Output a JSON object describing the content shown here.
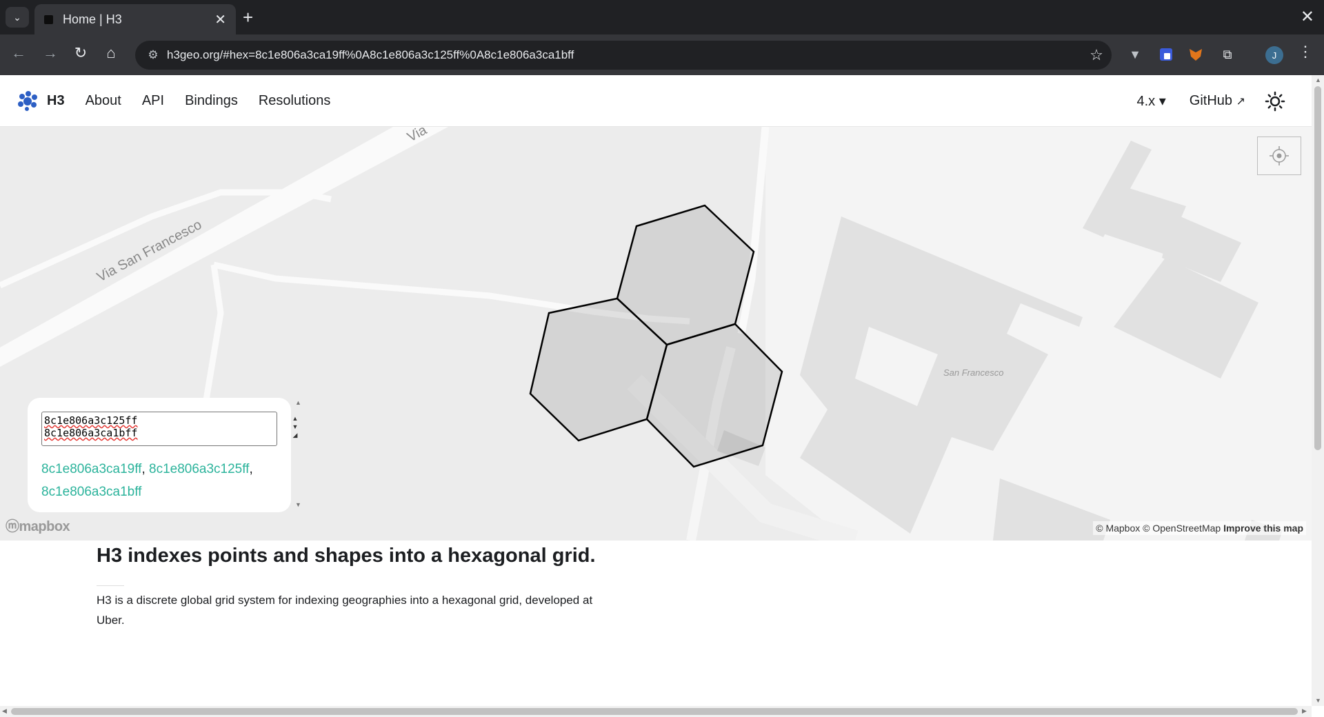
{
  "browser": {
    "tab_title": "Home | H3",
    "url": "h3geo.org/#hex=8c1e806a3ca19ff%0A8c1e806a3c125ff%0A8c1e806a3ca1bff",
    "avatar_initial": "J"
  },
  "site": {
    "brand": "H3",
    "nav": [
      "About",
      "API",
      "Bindings",
      "Resolutions"
    ],
    "version": "4.x",
    "github": "GitHub"
  },
  "map": {
    "street_label": "Via San Francesco",
    "street_label_top": "Via",
    "place_label": "San Francesco",
    "attribution_mapbox": "© Mapbox",
    "attribution_osm": "© OpenStreetMap",
    "attribution_improve": "Improve this map",
    "logo": "mapbox"
  },
  "panel": {
    "textarea_value": "8c1e806a3c125ff\n8c1e806a3ca1bff",
    "hexes": [
      "8c1e806a3ca19ff",
      "8c1e806a3c125ff",
      "8c1e806a3ca1bff"
    ]
  },
  "content": {
    "heading": "H3 indexes points and shapes into a hexagonal grid.",
    "paragraph": "H3 is a discrete global grid system for indexing geographies into a hexagonal grid, developed at Uber."
  },
  "colors": {
    "link": "#2bb39b",
    "map_bg": "#ececec",
    "building": "#e0e0e0",
    "road": "#ffffff"
  }
}
